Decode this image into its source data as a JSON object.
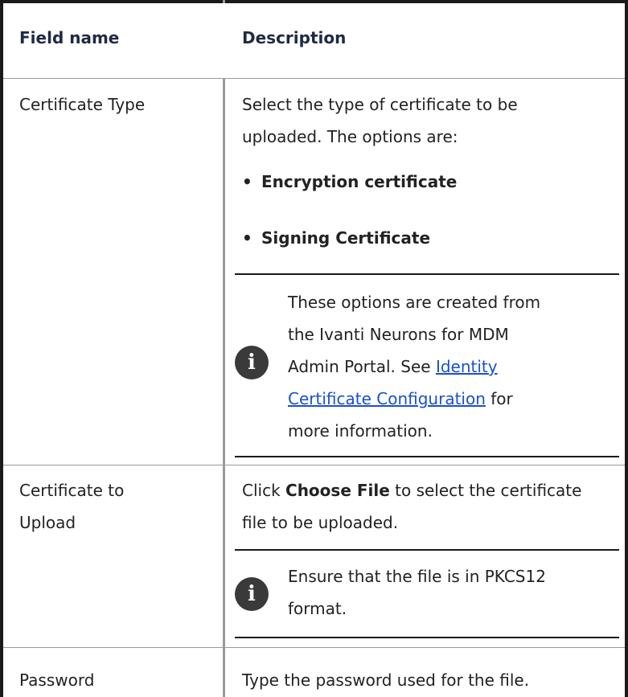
{
  "table": {
    "headers": {
      "field": "Field name",
      "description": "Description"
    },
    "rows": {
      "certificate_type": {
        "field": "Certificate Type",
        "desc_line1": "Select the type of certificate to be",
        "desc_line2": "uploaded. The options are:",
        "bullets": [
          "Encryption certificate",
          "Signing Certificate"
        ],
        "note": {
          "line1": "These options are created from",
          "line2": "the Ivanti Neurons for MDM",
          "line3_prefix": "Admin Portal. See ",
          "link_line1": "Identity",
          "link_line2": "Certificate Configuration",
          "line4_suffix": " for",
          "line5": "more information."
        }
      },
      "certificate_upload": {
        "field_line1": "Certificate to",
        "field_line2": "Upload",
        "desc_prefix": "Click ",
        "desc_bold": "Choose File",
        "desc_rest1": " to select the certificate",
        "desc_line2": "file to be uploaded.",
        "note": {
          "line1": "Ensure that the file is in PKCS12",
          "line2": "format."
        }
      },
      "password": {
        "field": "Password",
        "desc": "Type the password used for the file."
      }
    }
  },
  "icons": {
    "info": "info-icon",
    "bullet": "•",
    "info_glyph": "i"
  }
}
